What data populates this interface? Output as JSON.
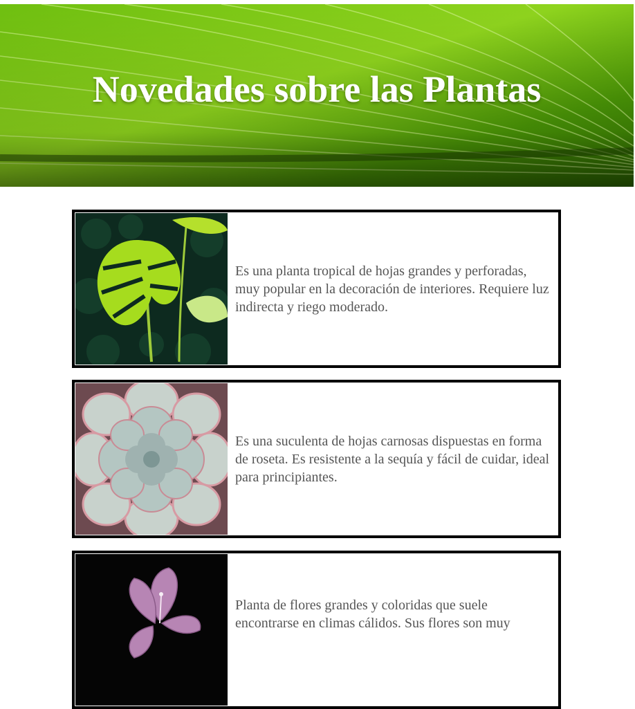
{
  "header": {
    "title": "Novedades sobre las Plantas",
    "background_image": "green-leaf-macro-photo"
  },
  "cards": [
    {
      "image": "monstera-plant-photo",
      "description": "Es una planta tropical de hojas grandes y perforadas, muy popular en la decoración de interiores. Requiere luz indirecta y riego moderado."
    },
    {
      "image": "echeveria-succulent-photo",
      "description": "Es una suculenta de hojas carnosas dispuestas en forma de roseta. Es resistente a la sequía y fácil de cuidar, ideal para principiantes."
    },
    {
      "image": "pink-hibiscus-flower-photo",
      "description": "Planta de flores grandes y coloridas que suele encontrarse en climas cálidos. Sus flores son muy"
    }
  ],
  "colors": {
    "card_border": "#000000",
    "card_text": "#555555",
    "title_text": "#ffffff",
    "leaf_green": "#5fae0a"
  }
}
